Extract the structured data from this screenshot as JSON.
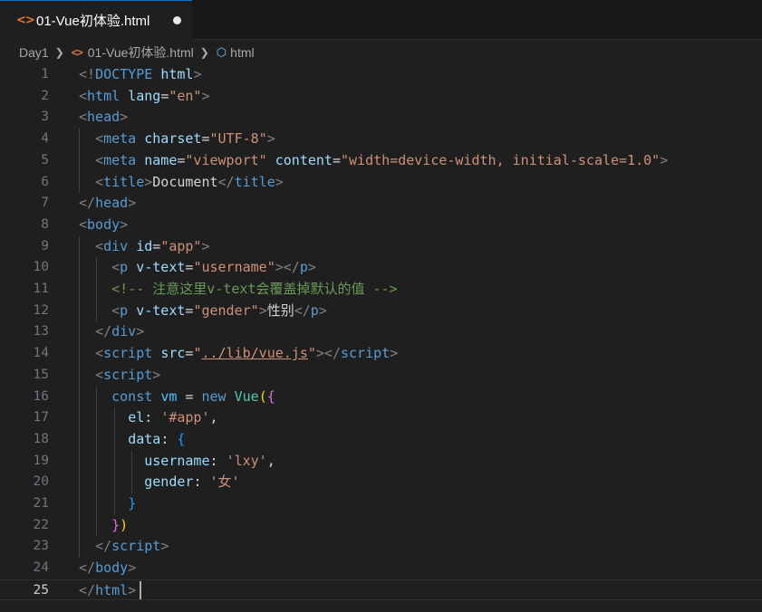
{
  "tab": {
    "label": "01-Vue初体验.html",
    "icon": "html-icon",
    "unsaved": true
  },
  "breadcrumb": {
    "items": [
      "Day1",
      "01-Vue初体验.html",
      "html"
    ]
  },
  "editor": {
    "current_line": 25,
    "lines": [
      {
        "n": "1",
        "tokens": [
          [
            "p",
            "<!"
          ],
          [
            "t",
            "DOCTYPE"
          ],
          [
            "tx",
            " "
          ],
          [
            "a",
            "html"
          ],
          [
            "p",
            ">"
          ]
        ]
      },
      {
        "n": "2",
        "tokens": [
          [
            "p",
            "<"
          ],
          [
            "t",
            "html"
          ],
          [
            "tx",
            " "
          ],
          [
            "a",
            "lang"
          ],
          [
            "tx",
            "="
          ],
          [
            "s",
            "\"en\""
          ],
          [
            "p",
            ">"
          ]
        ]
      },
      {
        "n": "3",
        "tokens": [
          [
            "p",
            "<"
          ],
          [
            "t",
            "head"
          ],
          [
            "p",
            ">"
          ]
        ]
      },
      {
        "n": "4",
        "tokens": [
          [
            "tx",
            "  "
          ],
          [
            "p",
            "<"
          ],
          [
            "t",
            "meta"
          ],
          [
            "tx",
            " "
          ],
          [
            "a",
            "charset"
          ],
          [
            "tx",
            "="
          ],
          [
            "s",
            "\"UTF-8\""
          ],
          [
            "p",
            ">"
          ]
        ]
      },
      {
        "n": "5",
        "tokens": [
          [
            "tx",
            "  "
          ],
          [
            "p",
            "<"
          ],
          [
            "t",
            "meta"
          ],
          [
            "tx",
            " "
          ],
          [
            "a",
            "name"
          ],
          [
            "tx",
            "="
          ],
          [
            "s",
            "\"viewport\""
          ],
          [
            "tx",
            " "
          ],
          [
            "a",
            "content"
          ],
          [
            "tx",
            "="
          ],
          [
            "s",
            "\"width=device-width, initial-scale=1.0\""
          ],
          [
            "p",
            ">"
          ]
        ]
      },
      {
        "n": "6",
        "tokens": [
          [
            "tx",
            "  "
          ],
          [
            "p",
            "<"
          ],
          [
            "t",
            "title"
          ],
          [
            "p",
            ">"
          ],
          [
            "tx",
            "Document"
          ],
          [
            "p",
            "</"
          ],
          [
            "t",
            "title"
          ],
          [
            "p",
            ">"
          ]
        ]
      },
      {
        "n": "7",
        "tokens": [
          [
            "p",
            "</"
          ],
          [
            "t",
            "head"
          ],
          [
            "p",
            ">"
          ]
        ]
      },
      {
        "n": "8",
        "tokens": [
          [
            "p",
            "<"
          ],
          [
            "t",
            "body"
          ],
          [
            "p",
            ">"
          ]
        ]
      },
      {
        "n": "9",
        "tokens": [
          [
            "tx",
            "  "
          ],
          [
            "p",
            "<"
          ],
          [
            "t",
            "div"
          ],
          [
            "tx",
            " "
          ],
          [
            "a",
            "id"
          ],
          [
            "tx",
            "="
          ],
          [
            "s",
            "\"app\""
          ],
          [
            "p",
            ">"
          ]
        ]
      },
      {
        "n": "10",
        "tokens": [
          [
            "tx",
            "    "
          ],
          [
            "p",
            "<"
          ],
          [
            "t",
            "p"
          ],
          [
            "tx",
            " "
          ],
          [
            "a",
            "v-text"
          ],
          [
            "tx",
            "="
          ],
          [
            "s",
            "\"username\""
          ],
          [
            "p",
            "></"
          ],
          [
            "t",
            "p"
          ],
          [
            "p",
            ">"
          ]
        ]
      },
      {
        "n": "11",
        "tokens": [
          [
            "tx",
            "    "
          ],
          [
            "c",
            "<!-- 注意这里v-text会覆盖掉默认的值 -->"
          ]
        ]
      },
      {
        "n": "12",
        "tokens": [
          [
            "tx",
            "    "
          ],
          [
            "p",
            "<"
          ],
          [
            "t",
            "p"
          ],
          [
            "tx",
            " "
          ],
          [
            "a",
            "v-text"
          ],
          [
            "tx",
            "="
          ],
          [
            "s",
            "\"gender\""
          ],
          [
            "p",
            ">"
          ],
          [
            "tx",
            "性别"
          ],
          [
            "p",
            "</"
          ],
          [
            "t",
            "p"
          ],
          [
            "p",
            ">"
          ]
        ]
      },
      {
        "n": "13",
        "tokens": [
          [
            "tx",
            "  "
          ],
          [
            "p",
            "</"
          ],
          [
            "t",
            "div"
          ],
          [
            "p",
            ">"
          ]
        ]
      },
      {
        "n": "14",
        "tokens": [
          [
            "tx",
            "  "
          ],
          [
            "p",
            "<"
          ],
          [
            "t",
            "script"
          ],
          [
            "tx",
            " "
          ],
          [
            "a",
            "src"
          ],
          [
            "tx",
            "="
          ],
          [
            "s",
            "\""
          ],
          [
            "s u",
            "../lib/vue.js"
          ],
          [
            "s",
            "\""
          ],
          [
            "p",
            "></"
          ],
          [
            "t",
            "script"
          ],
          [
            "p",
            ">"
          ]
        ]
      },
      {
        "n": "15",
        "tokens": [
          [
            "tx",
            "  "
          ],
          [
            "p",
            "<"
          ],
          [
            "t",
            "script"
          ],
          [
            "p",
            ">"
          ]
        ]
      },
      {
        "n": "16",
        "tokens": [
          [
            "tx",
            "    "
          ],
          [
            "k",
            "const"
          ],
          [
            "tx",
            " "
          ],
          [
            "v",
            "vm"
          ],
          [
            "tx",
            " = "
          ],
          [
            "k",
            "new"
          ],
          [
            "tx",
            " "
          ],
          [
            "f",
            "Vue"
          ],
          [
            "y1",
            "("
          ],
          [
            "m1",
            "{"
          ]
        ]
      },
      {
        "n": "17",
        "tokens": [
          [
            "tx",
            "      "
          ],
          [
            "pr",
            "el"
          ],
          [
            "tx",
            ": "
          ],
          [
            "s",
            "'#app'"
          ],
          [
            "tx",
            ","
          ]
        ]
      },
      {
        "n": "18",
        "tokens": [
          [
            "tx",
            "      "
          ],
          [
            "pr",
            "data"
          ],
          [
            "tx",
            ": "
          ],
          [
            "b1",
            "{"
          ]
        ]
      },
      {
        "n": "19",
        "tokens": [
          [
            "tx",
            "        "
          ],
          [
            "pr",
            "username"
          ],
          [
            "tx",
            ": "
          ],
          [
            "s",
            "'lxy'"
          ],
          [
            "tx",
            ","
          ]
        ]
      },
      {
        "n": "20",
        "tokens": [
          [
            "tx",
            "        "
          ],
          [
            "pr",
            "gender"
          ],
          [
            "tx",
            ": "
          ],
          [
            "s",
            "'女'"
          ]
        ]
      },
      {
        "n": "21",
        "tokens": [
          [
            "tx",
            "      "
          ],
          [
            "b1",
            "}"
          ]
        ]
      },
      {
        "n": "22",
        "tokens": [
          [
            "tx",
            "    "
          ],
          [
            "m1",
            "}"
          ],
          [
            "y1",
            ")"
          ]
        ]
      },
      {
        "n": "23",
        "tokens": [
          [
            "tx",
            "  "
          ],
          [
            "p",
            "</"
          ],
          [
            "t",
            "script"
          ],
          [
            "p",
            ">"
          ]
        ]
      },
      {
        "n": "24",
        "tokens": [
          [
            "p",
            "</"
          ],
          [
            "t",
            "body"
          ],
          [
            "p",
            ">"
          ]
        ]
      },
      {
        "n": "25",
        "tokens": [
          [
            "p",
            "</"
          ],
          [
            "t",
            "html"
          ],
          [
            "p",
            ">"
          ]
        ]
      }
    ]
  }
}
